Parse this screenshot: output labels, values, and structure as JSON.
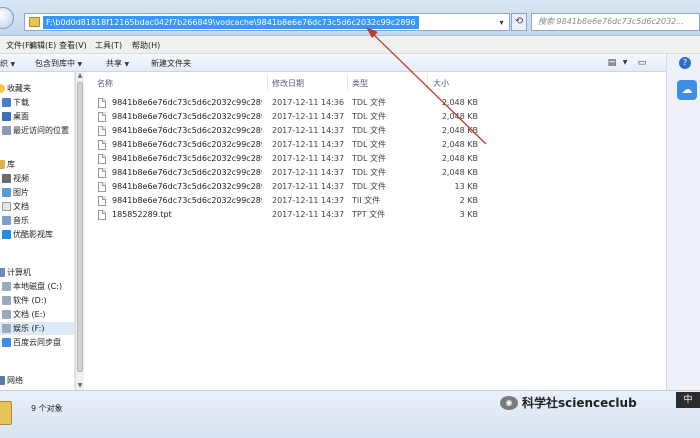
{
  "address_bar": {
    "path": "F:\\b0d0d81818f12165bdac042f7b266849\\vodcache\\9841b8e6e76dc73c5d6c2032c99c2896",
    "search_placeholder": "搜索 9841b8e6e76dc73c5d6c2032..."
  },
  "menu": {
    "items": [
      "文件(F)",
      "编辑(E)",
      "查看(V)",
      "工具(T)",
      "帮助(H)"
    ]
  },
  "toolbar": {
    "organize": "组织",
    "include_in_library": "包含到库中",
    "share": "共享",
    "new_folder": "新建文件夹"
  },
  "sidebar": {
    "favorites": "收藏夹",
    "downloads": "下载",
    "desktop": "桌面",
    "recent": "最近访问的位置",
    "libraries": "库",
    "videos": "视频",
    "pictures": "图片",
    "documents": "文档",
    "music": "音乐",
    "youku": "优酷影视库",
    "computer": "计算机",
    "drive_c": "本地磁盘 (C:)",
    "drive_d": "软件 (D:)",
    "drive_e": "文档 (E:)",
    "drive_f": "娱乐 (F:)",
    "baidu": "百度云同步盘",
    "network": "网络"
  },
  "columns": {
    "name": "名称",
    "date": "修改日期",
    "type": "类型",
    "size": "大小"
  },
  "files": [
    {
      "name": "9841b8e6e76dc73c5d6c2032c99c289...",
      "date": "2017-12-11 14:36",
      "type": "TDL 文件",
      "size": "2,048 KB"
    },
    {
      "name": "9841b8e6e76dc73c5d6c2032c99c289...",
      "date": "2017-12-11 14:37",
      "type": "TDL 文件",
      "size": "2,048 KB"
    },
    {
      "name": "9841b8e6e76dc73c5d6c2032c99c289...",
      "date": "2017-12-11 14:37",
      "type": "TDL 文件",
      "size": "2,048 KB"
    },
    {
      "name": "9841b8e6e76dc73c5d6c2032c99c289...",
      "date": "2017-12-11 14:37",
      "type": "TDL 文件",
      "size": "2,048 KB"
    },
    {
      "name": "9841b8e6e76dc73c5d6c2032c99c289...",
      "date": "2017-12-11 14:37",
      "type": "TDL 文件",
      "size": "2,048 KB"
    },
    {
      "name": "9841b8e6e76dc73c5d6c2032c99c289...",
      "date": "2017-12-11 14:37",
      "type": "TDL 文件",
      "size": "2,048 KB"
    },
    {
      "name": "9841b8e6e76dc73c5d6c2032c99c289...",
      "date": "2017-12-11 14:37",
      "type": "TDL 文件",
      "size": "13 KB"
    },
    {
      "name": "9841b8e6e76dc73c5d6c2032c99c289...",
      "date": "2017-12-11 14:37",
      "type": "TII 文件",
      "size": "2 KB"
    },
    {
      "name": "185852289.tpt",
      "date": "2017-12-11 14:37",
      "type": "TPT 文件",
      "size": "3 KB"
    }
  ],
  "status": {
    "count": "9 个对象"
  },
  "watermark": {
    "text": "科学社scienceclub",
    "lang": "中"
  },
  "colors": {
    "selection": "#3399ff",
    "arrow": "#c0392b"
  }
}
